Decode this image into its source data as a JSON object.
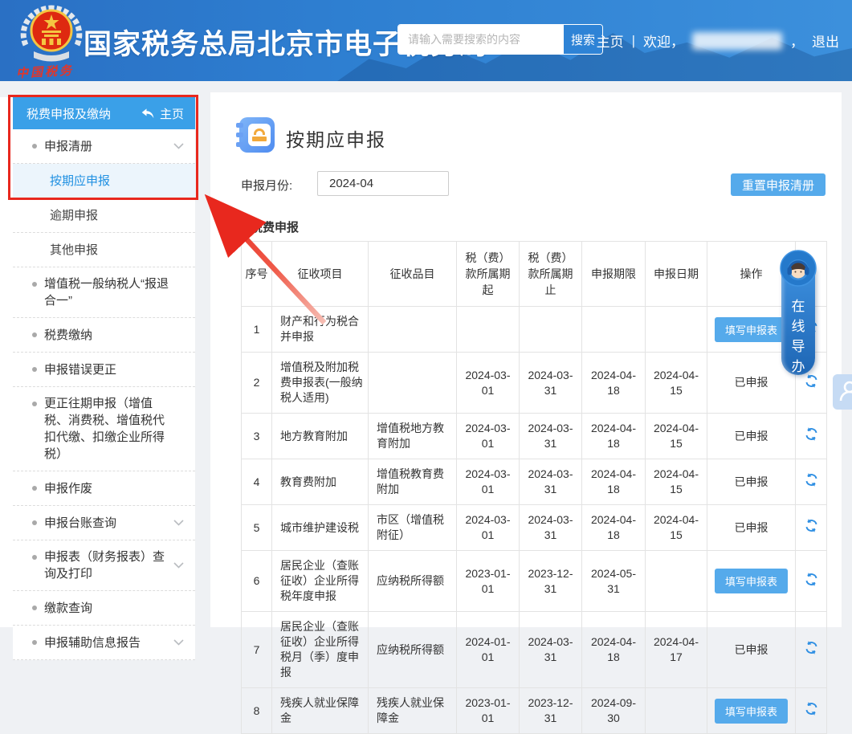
{
  "header": {
    "title": "国家税务总局北京市电子税务局",
    "logo_caption": "中国税务",
    "search": {
      "placeholder": "请输入需要搜索的内容",
      "button_label": "搜索"
    },
    "nav": {
      "home": "主页",
      "divider": "|",
      "welcome": "欢迎，",
      "comma": "，",
      "logout": "退出"
    }
  },
  "sidebar": {
    "header": {
      "title": "税费申报及缴纳",
      "home_link": "主页"
    },
    "items": [
      {
        "label": "申报清册",
        "level": 1,
        "bullet": true,
        "chevron": true
      },
      {
        "label": "按期应申报",
        "level": 2,
        "active": true
      },
      {
        "label": "逾期申报",
        "level": 2
      },
      {
        "label": "其他申报",
        "level": 2
      },
      {
        "label": "增值税一般纳税人“报退合一”",
        "level": 1,
        "bullet": true
      },
      {
        "label": "税费缴纳",
        "level": 1,
        "bullet": true
      },
      {
        "label": "申报错误更正",
        "level": 1,
        "bullet": true
      },
      {
        "label": "更正往期申报（增值税、消费税、增值税代扣代缴、扣缴企业所得税）",
        "level": 1,
        "bullet": true
      },
      {
        "label": "申报作废",
        "level": 1,
        "bullet": true
      },
      {
        "label": "申报台账查询",
        "level": 1,
        "bullet": true,
        "chevron": true
      },
      {
        "label": "申报表（财务报表）查询及打印",
        "level": 1,
        "bullet": true,
        "chevron": true
      },
      {
        "label": "缴款查询",
        "level": 1,
        "bullet": true
      },
      {
        "label": "申报辅助信息报告",
        "level": 1,
        "bullet": true,
        "chevron": true
      }
    ]
  },
  "main": {
    "page_title": "按期应申报",
    "month_label": "申报月份:",
    "month_value": "2024-04",
    "reset_button_label": "重置申报清册",
    "section_title": "税费申报",
    "table": {
      "headers": [
        "序号",
        "征收项目",
        "征收品目",
        "税（费）款所属期起",
        "税（费）款所属期止",
        "申报期限",
        "申报日期",
        "操作",
        ""
      ],
      "fill_button_label": "填写申报表",
      "declared_label": "已申报",
      "rows": [
        {
          "no": "1",
          "project": "财产和行为税合并申报",
          "item": "",
          "period_start": "",
          "period_end": "",
          "deadline": "",
          "file_date": "",
          "action": "fill"
        },
        {
          "no": "2",
          "project": "增值税及附加税费申报表(一般纳税人适用)",
          "item": "",
          "period_start": "2024-03-01",
          "period_end": "2024-03-31",
          "deadline": "2024-04-18",
          "file_date": "2024-04-15",
          "action": "declared"
        },
        {
          "no": "3",
          "project": "地方教育附加",
          "item": "增值税地方教育附加",
          "period_start": "2024-03-01",
          "period_end": "2024-03-31",
          "deadline": "2024-04-18",
          "file_date": "2024-04-15",
          "action": "declared"
        },
        {
          "no": "4",
          "project": "教育费附加",
          "item": "增值税教育费附加",
          "period_start": "2024-03-01",
          "period_end": "2024-03-31",
          "deadline": "2024-04-18",
          "file_date": "2024-04-15",
          "action": "declared"
        },
        {
          "no": "5",
          "project": "城市维护建设税",
          "item": "市区（增值税附征）",
          "period_start": "2024-03-01",
          "period_end": "2024-03-31",
          "deadline": "2024-04-18",
          "file_date": "2024-04-15",
          "action": "declared"
        },
        {
          "no": "6",
          "project": "居民企业（查账征收）企业所得税年度申报",
          "item": "应纳税所得额",
          "period_start": "2023-01-01",
          "period_end": "2023-12-31",
          "deadline": "2024-05-31",
          "file_date": "",
          "action": "fill"
        },
        {
          "no": "7",
          "project": "居民企业（查账征收）企业所得税月（季）度申报",
          "item": "应纳税所得额",
          "period_start": "2024-01-01",
          "period_end": "2024-03-31",
          "deadline": "2024-04-18",
          "file_date": "2024-04-17",
          "action": "declared"
        },
        {
          "no": "8",
          "project": "残疾人就业保障金",
          "item": "残疾人就业保障金",
          "period_start": "2023-01-01",
          "period_end": "2023-12-31",
          "deadline": "2024-09-30",
          "file_date": "",
          "action": "fill"
        }
      ]
    }
  },
  "floating": {
    "online_guide": "在线导办"
  },
  "colors": {
    "header_blue": "#2e7fd1",
    "sidebar_blue": "#3aa0e8",
    "button_blue": "#55aaeb",
    "annotation_red": "#e8281e"
  }
}
